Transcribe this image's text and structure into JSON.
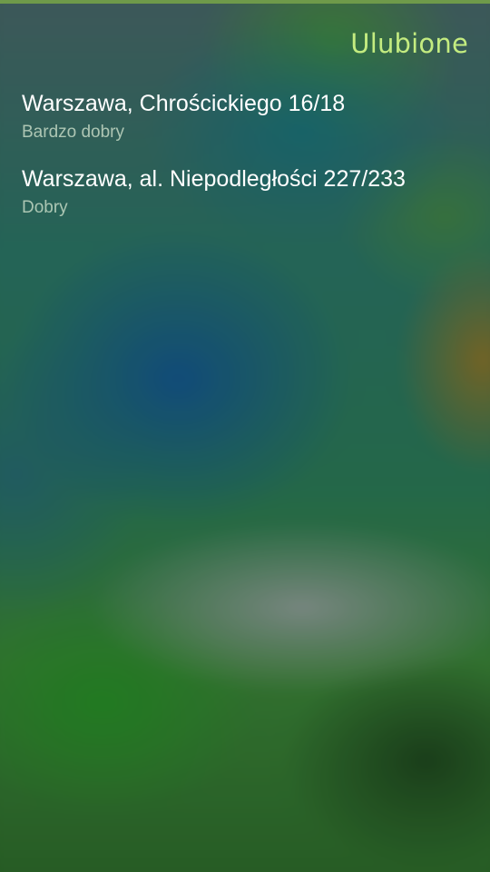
{
  "header": {
    "title": "Ulubione"
  },
  "favorites": [
    {
      "address": "Warszawa, Chrościckiego 16/18",
      "quality": "Bardzo dobry"
    },
    {
      "address": "Warszawa, al. Niepodległości 227/233",
      "quality": "Dobry"
    }
  ],
  "colors": {
    "accent": "#c4ec80",
    "secondary_text": "#d7e8d2"
  }
}
